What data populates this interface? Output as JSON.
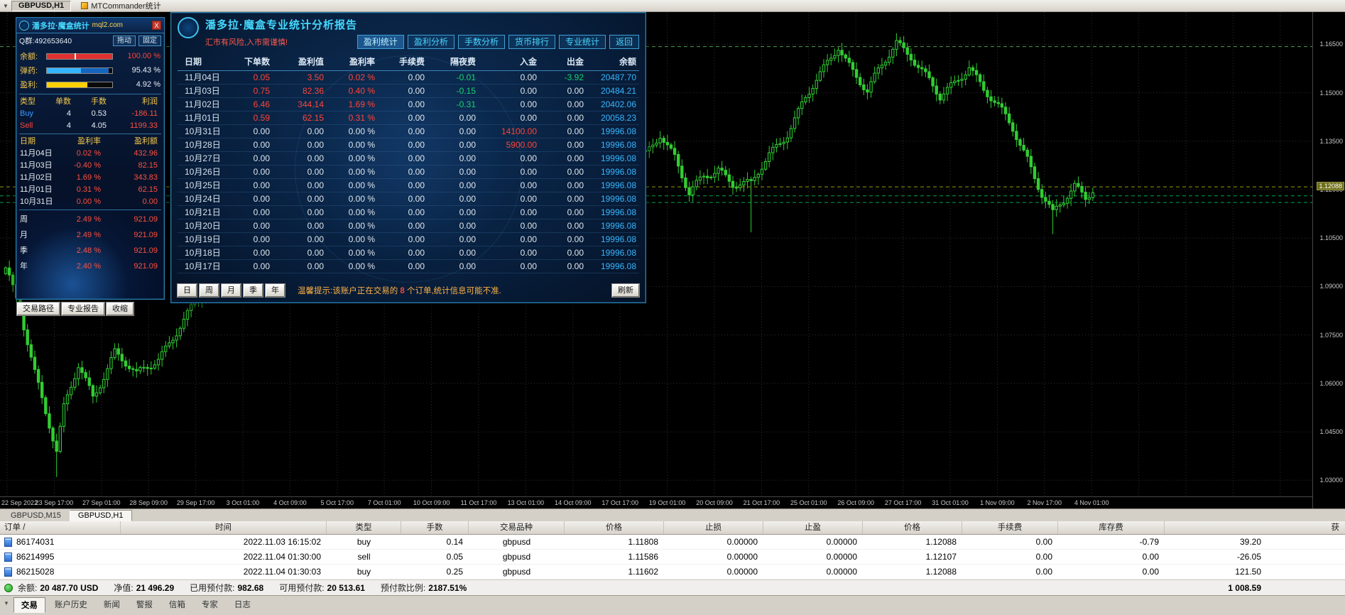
{
  "window": {
    "tabs": [
      {
        "label": "GBPUSD,H1"
      },
      {
        "label": "MTCommander统计"
      }
    ]
  },
  "icons": {
    "dropdown_glyph": "▼"
  },
  "left_panel": {
    "title": "潘多拉·魔盒统计",
    "title_suffix": "mql2.com",
    "close": "X",
    "qq": "Q群:492653640",
    "drag": "拖动",
    "fix": "固定",
    "gauges": [
      {
        "label": "余额:",
        "value": "100.00 %",
        "pct": 100,
        "color": "#e03030",
        "value_color": "#ff4438",
        "marker": 42
      },
      {
        "label": "弹药:",
        "value": "95.43 %",
        "pct": 95,
        "color": "linear-gradient(90deg,#35b5ff 55%,#1565c0 55%)",
        "value_color": "#e8eef5"
      },
      {
        "label": "盈利:",
        "value": "4.92 %",
        "pct": 62,
        "color": "#ffd000",
        "value_color": "#e8eef5"
      }
    ],
    "type_table": {
      "headers": [
        "类型",
        "单数",
        "手数",
        "利润"
      ],
      "rows": [
        [
          "Buy",
          "4",
          "0.53",
          "-186.11"
        ],
        [
          "Sell",
          "4",
          "4.05",
          "1199.33"
        ]
      ]
    },
    "daily_table": {
      "headers": [
        "日期",
        "盈利率",
        "盈利额"
      ],
      "rows": [
        [
          "11月04日",
          "0.02 %",
          "432.96"
        ],
        [
          "11月03日",
          "-0.40 %",
          "82.15"
        ],
        [
          "11月02日",
          "1.69 %",
          "343.83"
        ],
        [
          "11月01日",
          "0.31 %",
          "62.15"
        ],
        [
          "10月31日",
          "0.00 %",
          "0.00"
        ]
      ]
    },
    "period_rows": [
      [
        "周",
        "2.49 %",
        "921.09"
      ],
      [
        "月",
        "2.49 %",
        "921.09"
      ],
      [
        "季",
        "2.48 %",
        "921.09"
      ],
      [
        "年",
        "2.40 %",
        "921.09"
      ]
    ],
    "buttons": [
      "交易路径",
      "专业报告",
      "收缩"
    ]
  },
  "report_panel": {
    "title": "潘多拉·魔盒专业统计分析报告",
    "subtitle": "汇市有风险,入市需谨慎!",
    "tabs": [
      "盈利统计",
      "盈利分析",
      "手数分析",
      "货币排行",
      "专业统计",
      "返回"
    ],
    "table": {
      "headers": [
        "日期",
        "下单数",
        "盈利值",
        "盈利率",
        "手续费",
        "隔夜费",
        "入金",
        "出金",
        "余额"
      ],
      "rows": [
        [
          "11月04日",
          "0.05",
          "3.50",
          "0.02 %",
          "0.00",
          "-0.01",
          "0.00",
          "-3.92",
          "20487.70"
        ],
        [
          "11月03日",
          "0.75",
          "82.36",
          "0.40 %",
          "0.00",
          "-0.15",
          "0.00",
          "0.00",
          "20484.21"
        ],
        [
          "11月02日",
          "6.46",
          "344.14",
          "1.69 %",
          "0.00",
          "-0.31",
          "0.00",
          "0.00",
          "20402.06"
        ],
        [
          "11月01日",
          "0.59",
          "62.15",
          "0.31 %",
          "0.00",
          "0.00",
          "0.00",
          "0.00",
          "20058.23"
        ],
        [
          "10月31日",
          "0.00",
          "0.00",
          "0.00 %",
          "0.00",
          "0.00",
          "14100.00",
          "0.00",
          "19996.08"
        ],
        [
          "10月28日",
          "0.00",
          "0.00",
          "0.00 %",
          "0.00",
          "0.00",
          "5900.00",
          "0.00",
          "19996.08"
        ],
        [
          "10月27日",
          "0.00",
          "0.00",
          "0.00 %",
          "0.00",
          "0.00",
          "0.00",
          "0.00",
          "19996.08"
        ],
        [
          "10月26日",
          "0.00",
          "0.00",
          "0.00 %",
          "0.00",
          "0.00",
          "0.00",
          "0.00",
          "19996.08"
        ],
        [
          "10月25日",
          "0.00",
          "0.00",
          "0.00 %",
          "0.00",
          "0.00",
          "0.00",
          "0.00",
          "19996.08"
        ],
        [
          "10月24日",
          "0.00",
          "0.00",
          "0.00 %",
          "0.00",
          "0.00",
          "0.00",
          "0.00",
          "19996.08"
        ],
        [
          "10月21日",
          "0.00",
          "0.00",
          "0.00 %",
          "0.00",
          "0.00",
          "0.00",
          "0.00",
          "19996.08"
        ],
        [
          "10月20日",
          "0.00",
          "0.00",
          "0.00 %",
          "0.00",
          "0.00",
          "0.00",
          "0.00",
          "19996.08"
        ],
        [
          "10月19日",
          "0.00",
          "0.00",
          "0.00 %",
          "0.00",
          "0.00",
          "0.00",
          "0.00",
          "19996.08"
        ],
        [
          "10月18日",
          "0.00",
          "0.00",
          "0.00 %",
          "0.00",
          "0.00",
          "0.00",
          "0.00",
          "19996.08"
        ],
        [
          "10月17日",
          "0.00",
          "0.00",
          "0.00 %",
          "0.00",
          "0.00",
          "0.00",
          "0.00",
          "19996.08"
        ]
      ]
    },
    "period_buttons": [
      "日",
      "周",
      "月",
      "季",
      "年"
    ],
    "notice_prefix": "温馨提示:该账户正在交易的 ",
    "notice_count": "8",
    "notice_suffix": " 个订单,统计信息可能不准.",
    "refresh": "刷新"
  },
  "chart": {
    "symbol": "GBPUSD,H1",
    "top_price": 1.175,
    "bottom_price": 1.025,
    "price_ticks": [
      1.165,
      1.15,
      1.135,
      1.12,
      1.105,
      1.09,
      1.075,
      1.06,
      1.045,
      1.03
    ],
    "current_price_label": "1.12088",
    "current_price": 1.12088,
    "dates": [
      "22 Sep 2022",
      "23 Sep 17:00",
      "27 Sep 01:00",
      "28 Sep 09:00",
      "29 Sep 17:00",
      "3 Oct 01:00",
      "4 Oct 09:00",
      "5 Oct 17:00",
      "7 Oct 01:00",
      "10 Oct 09:00",
      "11 Oct 17:00",
      "13 Oct 01:00",
      "14 Oct 09:00",
      "17 Oct 17:00",
      "19 Oct 01:00",
      "20 Oct 09:00",
      "21 Oct 17:00",
      "25 Oct 01:00",
      "26 Oct 09:00",
      "27 Oct 17:00",
      "31 Oct 01:00",
      "1 Nov 09:00",
      "2 Nov 17:00",
      "4 Nov 01:00"
    ],
    "lines": [
      {
        "price": 1.1643,
        "color": "#4f9e4f"
      },
      {
        "price": 1.12088,
        "color": "#9aa000"
      },
      {
        "price": 1.11808,
        "color": "#00a550"
      },
      {
        "price": 1.11602,
        "color": "#00a550"
      }
    ],
    "anchors": [
      [
        0,
        1.095
      ],
      [
        4,
        1.082
      ],
      [
        8,
        1.064
      ],
      [
        12,
        1.048
      ],
      [
        14,
        1.039
      ],
      [
        16,
        1.052
      ],
      [
        20,
        1.065
      ],
      [
        24,
        1.056
      ],
      [
        30,
        1.07
      ],
      [
        36,
        1.062
      ],
      [
        42,
        1.068
      ],
      [
        48,
        1.078
      ],
      [
        56,
        1.09
      ],
      [
        68,
        1.105
      ],
      [
        80,
        1.118
      ],
      [
        92,
        1.13
      ],
      [
        104,
        1.142
      ],
      [
        112,
        1.136
      ],
      [
        120,
        1.125
      ],
      [
        128,
        1.131
      ],
      [
        136,
        1.133
      ],
      [
        144,
        1.128
      ],
      [
        152,
        1.134
      ],
      [
        160,
        1.13
      ],
      [
        168,
        1.133
      ],
      [
        176,
        1.131
      ],
      [
        180,
        1.138
      ],
      [
        184,
        1.13
      ],
      [
        188,
        1.118
      ],
      [
        192,
        1.124
      ],
      [
        196,
        1.127
      ],
      [
        200,
        1.122
      ],
      [
        205,
        1.121
      ],
      [
        210,
        1.131
      ],
      [
        215,
        1.138
      ],
      [
        220,
        1.148
      ],
      [
        225,
        1.157
      ],
      [
        229,
        1.165
      ],
      [
        233,
        1.157
      ],
      [
        237,
        1.15
      ],
      [
        241,
        1.158
      ],
      [
        245,
        1.166
      ],
      [
        249,
        1.162
      ],
      [
        253,
        1.155
      ],
      [
        257,
        1.148
      ],
      [
        261,
        1.153
      ],
      [
        265,
        1.159
      ],
      [
        269,
        1.151
      ],
      [
        273,
        1.145
      ],
      [
        277,
        1.139
      ],
      [
        281,
        1.13
      ],
      [
        285,
        1.119
      ],
      [
        288,
        1.112
      ],
      [
        291,
        1.116
      ],
      [
        294,
        1.121
      ],
      [
        297,
        1.118
      ],
      [
        299,
        1.121
      ]
    ],
    "spikes": [
      [
        14,
        1.031
      ],
      [
        205,
        1.1068
      ],
      [
        288,
        1.1062
      ]
    ],
    "colors": {
      "candle": "#32cd32",
      "bull_fill": "#02120a",
      "grid": "#2f2f2f",
      "axis_text": "#c9c9c9"
    }
  },
  "bottom_tabs": [
    "GBPUSD,M15",
    "GBPUSD,H1"
  ],
  "terminal": {
    "headers": [
      "订单 /",
      "时间",
      "类型",
      "手数",
      "交易品种",
      "价格",
      "止损",
      "止盈",
      "价格",
      "手续费",
      "库存费",
      "获"
    ],
    "rows": [
      [
        "86174031",
        "2022.11.03 16:15:02",
        "buy",
        "0.14",
        "gbpusd",
        "1.11808",
        "0.00000",
        "0.00000",
        "1.12088",
        "0.00",
        "-0.79",
        "39.20"
      ],
      [
        "86214995",
        "2022.11.04 01:30:00",
        "sell",
        "0.05",
        "gbpusd",
        "1.11586",
        "0.00000",
        "0.00000",
        "1.12107",
        "0.00",
        "0.00",
        "-26.05"
      ],
      [
        "86215028",
        "2022.11.04 01:30:03",
        "buy",
        "0.25",
        "gbpusd",
        "1.11602",
        "0.00000",
        "0.00000",
        "1.12088",
        "0.00",
        "0.00",
        "121.50"
      ]
    ],
    "summary": {
      "balance_label": "余额:",
      "balance": "20 487.70 USD",
      "equity_label": "净值:",
      "equity": "21 496.29",
      "margin_label": "已用预付款:",
      "margin": "982.68",
      "free_label": "可用预付款:",
      "free": "20 513.61",
      "level_label": "预付款比例:",
      "level": "2187.51%",
      "profit": "1 008.59"
    },
    "tabs": [
      "交易",
      "账户历史",
      "新闻",
      "警报",
      "信箱",
      "专家",
      "日志"
    ]
  }
}
